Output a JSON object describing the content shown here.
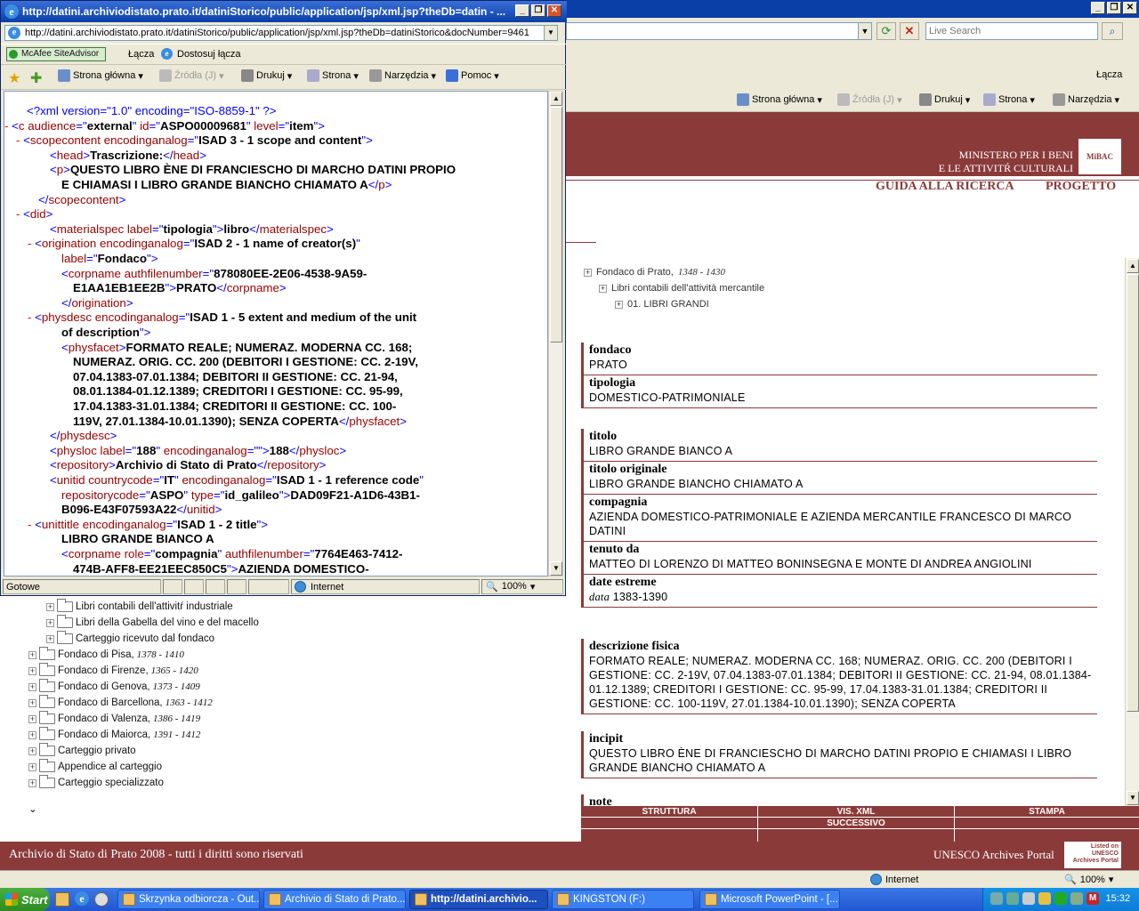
{
  "bg_window": {
    "search_placeholder": "Live Search",
    "links_label": "Łącza",
    "commands": [
      {
        "label": "Strona główna",
        "icon": "home-icon"
      },
      {
        "label": "Źródła (J)",
        "icon": "feeds-icon"
      },
      {
        "label": "Drukuj",
        "icon": "print-icon"
      },
      {
        "label": "Strona",
        "icon": "page-icon"
      },
      {
        "label": "Narzędzia",
        "icon": "tools-icon"
      }
    ],
    "status_zone": "Internet",
    "status_zoom": "100%"
  },
  "site": {
    "ministry": [
      "MINISTERO PER I BENI",
      "E LE ATTIVITŔ CULTURALI"
    ],
    "logo": "MiBAC",
    "nav": [
      "GUIDA ALLA RICERCA",
      "PROGETTO"
    ],
    "tree": [
      {
        "label": "Fondaco di Prato,",
        "dates": "1348 - 1430"
      },
      {
        "label": "Libri contabili dell'attività mercantile",
        "dates": ""
      },
      {
        "label": "01. LIBRI GRANDI",
        "dates": ""
      }
    ],
    "groups": [
      [
        {
          "label": "fondaco",
          "value": "PRATO"
        },
        {
          "label": "tipologia",
          "value": "DOMESTICO-PATRIMONIALE"
        }
      ],
      [
        {
          "label": "titolo",
          "value": "LIBRO GRANDE BIANCO A"
        },
        {
          "label": "titolo originale",
          "value": "LIBRO GRANDE BIANCHO CHIAMATO A"
        },
        {
          "label": "compagnia",
          "value": "AZIENDA DOMESTICO-PATRIMONIALE E AZIENDA MERCANTILE FRANCESCO DI MARCO DATINI"
        },
        {
          "label": "tenuto da",
          "value": "MATTEO DI LORENZO DI MATTEO BONINSEGNA E MONTE DI ANDREA ANGIOLINI"
        },
        {
          "label": "date estreme",
          "value_prefix": "data",
          "value": "1383-1390"
        }
      ],
      [
        {
          "label": "descrizione fisica",
          "value": "FORMATO REALE; NUMERAZ. MODERNA CC. 168; NUMERAZ. ORIG. CC. 200 (DEBITORI I GESTIONE: CC. 2-19V, 07.04.1383-07.01.1384; DEBITORI II GESTIONE: CC. 21-94, 08.01.1384-01.12.1389; CREDITORI I GESTIONE: CC. 95-99, 17.04.1383-31.01.1384; CREDITORI II GESTIONE: CC. 100-119V, 27.01.1384-10.01.1390); SENZA COPERTA"
        }
      ],
      [
        {
          "label": "incipit",
          "value": "QUESTO LIBRO ÈNE DI FRANCIESCHO DI MARCHO DATINI PROPIO E CHIAMASI I LIBRO GRANDE BIANCHO CHIAMATO A"
        }
      ],
      [
        {
          "label": "note",
          "value": ""
        }
      ]
    ],
    "buttons": {
      "struttura": "STRUTTURA",
      "vis_xml": "VIS. XML",
      "stampa": "STAMPA",
      "successivo": "SUCCESSIVO"
    },
    "footer": "Archivio di Stato di Prato 2008 - tutti i diritti sono riservati",
    "footer_right": "UNESCO Archives Portal",
    "unesco_badge": "Listed on UNESCO Archives Portal"
  },
  "left_tree": [
    {
      "label": "Libri contabili dell'attivitŕ industriale",
      "dates": "",
      "indent": 1
    },
    {
      "label": "Libri della Gabella del vino e del macello",
      "dates": "",
      "indent": 1
    },
    {
      "label": "Carteggio ricevuto dal fondaco",
      "dates": "",
      "indent": 1
    },
    {
      "label": "Fondaco di Pisa,",
      "dates": "1378 - 1410",
      "indent": 0
    },
    {
      "label": "Fondaco di Firenze,",
      "dates": "1365 - 1420",
      "indent": 0
    },
    {
      "label": "Fondaco di Genova,",
      "dates": "1373 - 1409",
      "indent": 0
    },
    {
      "label": "Fondaco di Barcellona,",
      "dates": "1363 - 1412",
      "indent": 0
    },
    {
      "label": "Fondaco di Valenza,",
      "dates": "1386 - 1419",
      "indent": 0
    },
    {
      "label": "Fondaco di Maiorca,",
      "dates": "1391 - 1412",
      "indent": 0
    },
    {
      "label": "Carteggio privato",
      "dates": "",
      "indent": 0
    },
    {
      "label": "Appendice al carteggio",
      "dates": "",
      "indent": 0
    },
    {
      "label": "Carteggio specializzato",
      "dates": "",
      "indent": 0
    }
  ],
  "popup": {
    "title": "http://datini.archiviodistato.prato.it/datiniStorico/public/application/jsp/xml.jsp?theDb=datin - ...",
    "address": "http://datini.archiviodistato.prato.it/datiniStorico/public/application/jsp/xml.jsp?theDb=datiniStorico&docNumber=9461",
    "mcafee": "McAfee SiteAdvisor",
    "links_label": "Łącza",
    "customize_links": "Dostosuj łącza",
    "commands": [
      {
        "label": "Strona główna",
        "icon": "home-icon"
      },
      {
        "label": "Źródła (J)",
        "icon": "feeds-icon"
      },
      {
        "label": "Drukuj",
        "icon": "print-icon"
      },
      {
        "label": "Strona",
        "icon": "page-icon"
      },
      {
        "label": "Narzędzia",
        "icon": "tools-icon"
      },
      {
        "label": "Pomoc",
        "icon": "help-icon"
      }
    ],
    "status": "Gotowe",
    "status_zone": "Internet",
    "status_zoom": "100%",
    "xml_lines": [
      {
        "ind": 1,
        "dash": "",
        "parts": [
          [
            "mk",
            "<?xml version=\"1.0\" encoding=\"ISO-8859-1\" ?>"
          ]
        ]
      },
      {
        "ind": 0,
        "dash": "-",
        "parts": [
          [
            "mk",
            "<"
          ],
          [
            "tn",
            "c"
          ],
          [
            "tn",
            " audience"
          ],
          [
            "mk",
            "=\""
          ],
          [
            "av",
            "external"
          ],
          [
            "mk",
            "\""
          ],
          [
            "tn",
            " id"
          ],
          [
            "mk",
            "=\""
          ],
          [
            "av",
            "ASPO00009681"
          ],
          [
            "mk",
            "\""
          ],
          [
            "tn",
            " level"
          ],
          [
            "mk",
            "=\""
          ],
          [
            "av",
            "item"
          ],
          [
            "mk",
            "\">"
          ]
        ]
      },
      {
        "ind": 1,
        "dash": "-",
        "parts": [
          [
            "mk",
            "<"
          ],
          [
            "tn",
            "scopecontent"
          ],
          [
            "tn",
            " encodinganalog"
          ],
          [
            "mk",
            "=\""
          ],
          [
            "av",
            "ISAD 3 - 1 scope and content"
          ],
          [
            "mk",
            "\">"
          ]
        ]
      },
      {
        "ind": 3,
        "dash": "",
        "parts": [
          [
            "mk",
            "<"
          ],
          [
            "tn",
            "head"
          ],
          [
            "mk",
            ">"
          ],
          [
            "tx",
            "Trascrizione:"
          ],
          [
            "mk",
            "</"
          ],
          [
            "tn",
            "head"
          ],
          [
            "mk",
            ">"
          ]
        ]
      },
      {
        "ind": 3,
        "dash": "",
        "parts": [
          [
            "mk",
            "<"
          ],
          [
            "tn",
            "p"
          ],
          [
            "mk",
            ">"
          ],
          [
            "tx",
            "QUESTO LIBRO ÈNE DI FRANCIESCHO DI MARCHO DATINI PROPIO"
          ]
        ]
      },
      {
        "ind": 4,
        "dash": "",
        "parts": [
          [
            "tx",
            "E CHIAMASI I LIBRO GRANDE BIANCHO CHIAMATO A"
          ],
          [
            "mk",
            "</"
          ],
          [
            "tn",
            "p"
          ],
          [
            "mk",
            ">"
          ]
        ]
      },
      {
        "ind": 2,
        "dash": "",
        "parts": [
          [
            "mk",
            "</"
          ],
          [
            "tn",
            "scopecontent"
          ],
          [
            "mk",
            ">"
          ]
        ]
      },
      {
        "ind": 1,
        "dash": "-",
        "parts": [
          [
            "mk",
            "<"
          ],
          [
            "tn",
            "did"
          ],
          [
            "mk",
            ">"
          ]
        ]
      },
      {
        "ind": 3,
        "dash": "",
        "parts": [
          [
            "mk",
            "<"
          ],
          [
            "tn",
            "materialspec"
          ],
          [
            "tn",
            " label"
          ],
          [
            "mk",
            "=\""
          ],
          [
            "av",
            "tipologia"
          ],
          [
            "mk",
            "\">"
          ],
          [
            "tx",
            "libro"
          ],
          [
            "mk",
            "</"
          ],
          [
            "tn",
            "materialspec"
          ],
          [
            "mk",
            ">"
          ]
        ]
      },
      {
        "ind": 2,
        "dash": "-",
        "parts": [
          [
            "mk",
            "<"
          ],
          [
            "tn",
            "origination"
          ],
          [
            "tn",
            " encodinganalog"
          ],
          [
            "mk",
            "=\""
          ],
          [
            "av",
            "ISAD 2 - 1 name of creator(s)"
          ],
          [
            "mk",
            "\""
          ]
        ]
      },
      {
        "ind": 4,
        "dash": "",
        "parts": [
          [
            "tn",
            "label"
          ],
          [
            "mk",
            "=\""
          ],
          [
            "av",
            "Fondaco"
          ],
          [
            "mk",
            "\">"
          ]
        ]
      },
      {
        "ind": 4,
        "dash": "",
        "parts": [
          [
            "mk",
            "<"
          ],
          [
            "tn",
            "corpname"
          ],
          [
            "tn",
            " authfilenumber"
          ],
          [
            "mk",
            "=\""
          ],
          [
            "av",
            "878080EE-2E06-4538-9A59-"
          ]
        ]
      },
      {
        "ind": 5,
        "dash": "",
        "parts": [
          [
            "av",
            "E1AA1EB1EE2B"
          ],
          [
            "mk",
            "\">"
          ],
          [
            "tx",
            "PRATO"
          ],
          [
            "mk",
            "</"
          ],
          [
            "tn",
            "corpname"
          ],
          [
            "mk",
            ">"
          ]
        ]
      },
      {
        "ind": 4,
        "dash": "",
        "parts": [
          [
            "mk",
            "</"
          ],
          [
            "tn",
            "origination"
          ],
          [
            "mk",
            ">"
          ]
        ]
      },
      {
        "ind": 2,
        "dash": "-",
        "parts": [
          [
            "mk",
            "<"
          ],
          [
            "tn",
            "physdesc"
          ],
          [
            "tn",
            " encodinganalog"
          ],
          [
            "mk",
            "=\""
          ],
          [
            "av",
            "ISAD 1 - 5 extent and medium of the unit"
          ]
        ]
      },
      {
        "ind": 4,
        "dash": "",
        "parts": [
          [
            "av",
            "of description"
          ],
          [
            "mk",
            "\">"
          ]
        ]
      },
      {
        "ind": 4,
        "dash": "",
        "parts": [
          [
            "mk",
            "<"
          ],
          [
            "tn",
            "physfacet"
          ],
          [
            "mk",
            ">"
          ],
          [
            "tx",
            "FORMATO REALE; NUMERAZ. MODERNA CC. 168;"
          ]
        ]
      },
      {
        "ind": 5,
        "dash": "",
        "parts": [
          [
            "tx",
            "NUMERAZ. ORIG. CC. 200 (DEBITORI I GESTIONE: CC. 2-19V,"
          ]
        ]
      },
      {
        "ind": 5,
        "dash": "",
        "parts": [
          [
            "tx",
            "07.04.1383-07.01.1384; DEBITORI II GESTIONE: CC. 21-94,"
          ]
        ]
      },
      {
        "ind": 5,
        "dash": "",
        "parts": [
          [
            "tx",
            "08.01.1384-01.12.1389; CREDITORI I GESTIONE: CC. 95-99,"
          ]
        ]
      },
      {
        "ind": 5,
        "dash": "",
        "parts": [
          [
            "tx",
            "17.04.1383-31.01.1384; CREDITORI II GESTIONE: CC. 100-"
          ]
        ]
      },
      {
        "ind": 5,
        "dash": "",
        "parts": [
          [
            "tx",
            "119V, 27.01.1384-10.01.1390); SENZA COPERTA"
          ],
          [
            "mk",
            "</"
          ],
          [
            "tn",
            "physfacet"
          ],
          [
            "mk",
            ">"
          ]
        ]
      },
      {
        "ind": 3,
        "dash": "",
        "parts": [
          [
            "mk",
            "</"
          ],
          [
            "tn",
            "physdesc"
          ],
          [
            "mk",
            ">"
          ]
        ]
      },
      {
        "ind": 3,
        "dash": "",
        "parts": [
          [
            "mk",
            "<"
          ],
          [
            "tn",
            "physloc"
          ],
          [
            "tn",
            " label"
          ],
          [
            "mk",
            "=\""
          ],
          [
            "av",
            "188"
          ],
          [
            "mk",
            "\""
          ],
          [
            "tn",
            " encodinganalog"
          ],
          [
            "mk",
            "=\"\">"
          ],
          [
            "tx",
            "188"
          ],
          [
            "mk",
            "</"
          ],
          [
            "tn",
            "physloc"
          ],
          [
            "mk",
            ">"
          ]
        ]
      },
      {
        "ind": 3,
        "dash": "",
        "parts": [
          [
            "mk",
            "<"
          ],
          [
            "tn",
            "repository"
          ],
          [
            "mk",
            ">"
          ],
          [
            "tx",
            "Archivio di Stato di Prato"
          ],
          [
            "mk",
            "</"
          ],
          [
            "tn",
            "repository"
          ],
          [
            "mk",
            ">"
          ]
        ]
      },
      {
        "ind": 3,
        "dash": "",
        "parts": [
          [
            "mk",
            "<"
          ],
          [
            "tn",
            "unitid"
          ],
          [
            "tn",
            " countrycode"
          ],
          [
            "mk",
            "=\""
          ],
          [
            "av",
            "IT"
          ],
          [
            "mk",
            "\""
          ],
          [
            "tn",
            " encodinganalog"
          ],
          [
            "mk",
            "=\""
          ],
          [
            "av",
            "ISAD 1 - 1 reference code"
          ],
          [
            "mk",
            "\""
          ]
        ]
      },
      {
        "ind": 4,
        "dash": "",
        "parts": [
          [
            "tn",
            "repositorycode"
          ],
          [
            "mk",
            "=\""
          ],
          [
            "av",
            "ASPO"
          ],
          [
            "mk",
            "\""
          ],
          [
            "tn",
            " type"
          ],
          [
            "mk",
            "=\""
          ],
          [
            "av",
            "id_galileo"
          ],
          [
            "mk",
            "\">"
          ],
          [
            "tx",
            "DAD09F21-A1D6-43B1-"
          ]
        ]
      },
      {
        "ind": 4,
        "dash": "",
        "parts": [
          [
            "tx",
            "B096-E43F07593A22"
          ],
          [
            "mk",
            "</"
          ],
          [
            "tn",
            "unitid"
          ],
          [
            "mk",
            ">"
          ]
        ]
      },
      {
        "ind": 2,
        "dash": "-",
        "parts": [
          [
            "mk",
            "<"
          ],
          [
            "tn",
            "unittitle"
          ],
          [
            "tn",
            " encodinganalog"
          ],
          [
            "mk",
            "=\""
          ],
          [
            "av",
            "ISAD 1 - 2 title"
          ],
          [
            "mk",
            "\">"
          ]
        ]
      },
      {
        "ind": 4,
        "dash": "",
        "parts": [
          [
            "tx",
            "LIBRO GRANDE BIANCO A"
          ]
        ]
      },
      {
        "ind": 4,
        "dash": "",
        "parts": [
          [
            "mk",
            "<"
          ],
          [
            "tn",
            "corpname"
          ],
          [
            "tn",
            " role"
          ],
          [
            "mk",
            "=\""
          ],
          [
            "av",
            "compagnia"
          ],
          [
            "mk",
            "\""
          ],
          [
            "tn",
            " authfilenumber"
          ],
          [
            "mk",
            "=\""
          ],
          [
            "av",
            "7764E463-7412-"
          ]
        ]
      },
      {
        "ind": 5,
        "dash": "",
        "parts": [
          [
            "av",
            "474B-AFF8-EE21EEC850C5"
          ],
          [
            "mk",
            "\">"
          ],
          [
            "tx",
            "AZIENDA DOMESTICO-"
          ]
        ]
      }
    ]
  },
  "taskbar": {
    "start": "Start",
    "items": [
      {
        "label": "Skrzynka odbiorcza - Out...",
        "active": false
      },
      {
        "label": "Archivio di Stato di Prato...",
        "active": false
      },
      {
        "label": "http://datini.archivio...",
        "active": true
      },
      {
        "label": "KINGSTON (F:)",
        "active": false
      },
      {
        "label": "Microsoft PowerPoint - [...",
        "active": false
      }
    ],
    "clock": "15:32"
  }
}
